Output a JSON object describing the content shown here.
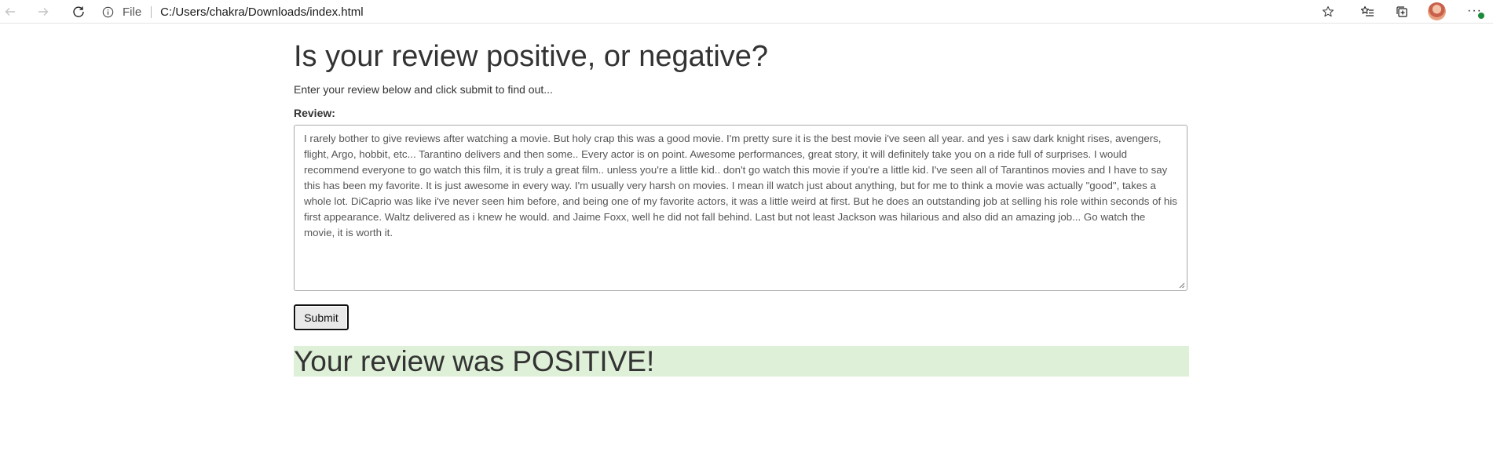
{
  "browser": {
    "scheme": "File",
    "url": "C:/Users/chakra/Downloads/index.html"
  },
  "page": {
    "title": "Is your review positive, or negative?",
    "subtitle": "Enter your review below and click submit to find out...",
    "review_label": "Review:",
    "review_text": "I rarely bother to give reviews after watching a movie. But holy crap this was a good movie. I'm pretty sure it is the best movie i've seen all year. and yes i saw dark knight rises, avengers, flight, Argo, hobbit, etc... Tarantino delivers and then some.. Every actor is on point. Awesome performances, great story, it will definitely take you on a ride full of surprises. I would recommend everyone to go watch this film, it is truly a great film.. unless you're a little kid.. don't go watch this movie if you're a little kid. I've seen all of Tarantinos movies and I have to say this has been my favorite. It is just awesome in every way. I'm usually very harsh on movies. I mean ill watch just about anything, but for me to think a movie was actually \"good\", takes a whole lot. DiCaprio was like i've never seen him before, and being one of my favorite actors, it was a little weird at first. But he does an outstanding job at selling his role within seconds of his first appearance. Waltz delivered as i knew he would. and Jaime Foxx, well he did not fall behind. Last but not least Jackson was hilarious and also did an amazing job... Go watch the movie, it is worth it.",
    "submit_label": "Submit",
    "result_text": "Your review was POSITIVE!",
    "result_bg": "#dff0d8"
  },
  "icons": {
    "back": "arrow-left-icon",
    "forward": "arrow-right-icon",
    "reload": "reload-icon",
    "info": "info-icon",
    "favorite": "star-icon",
    "favorites": "favorites-list-icon",
    "collections": "collections-icon",
    "profile": "avatar",
    "more": "more-icon"
  }
}
